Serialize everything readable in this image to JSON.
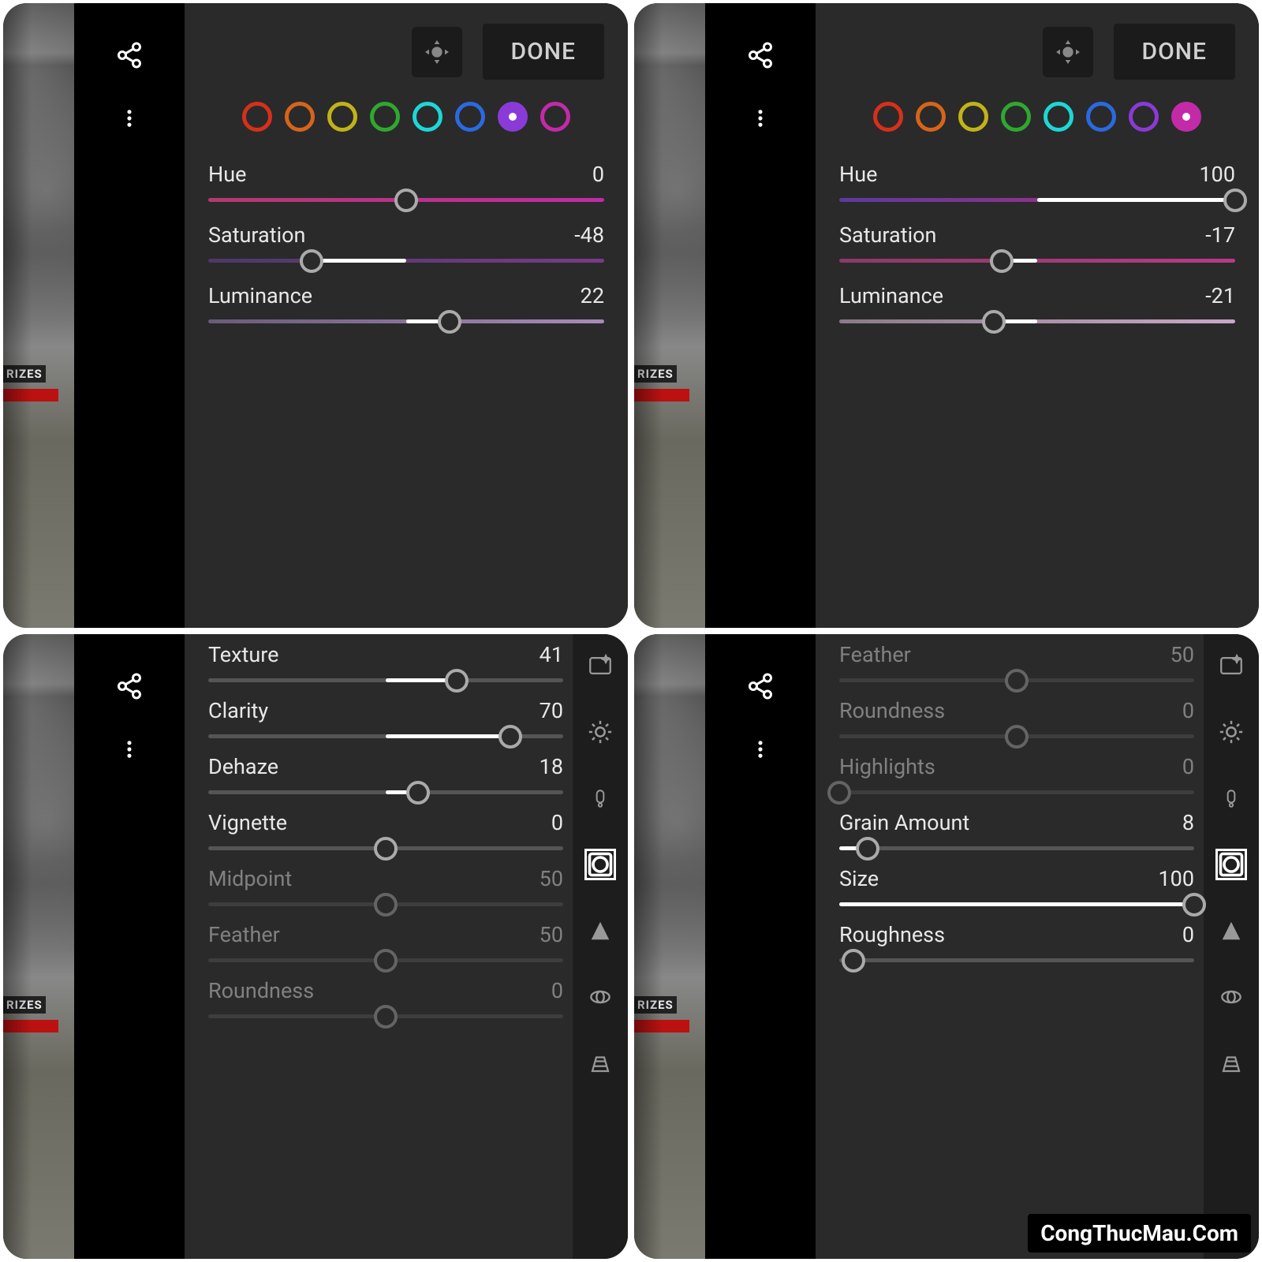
{
  "top": {
    "done": "DONE",
    "prizes": "RIZES"
  },
  "swatchColors": [
    "#d6301a",
    "#d6641a",
    "#c2b21a",
    "#2fa82f",
    "#1ed6d6",
    "#2a6ae0",
    "#8a3ad6",
    "#c22aa8"
  ],
  "panel1": {
    "selectedSwatch": 6,
    "sliders": [
      {
        "label": "Hue",
        "value": "0",
        "knob": 50,
        "leftColor": "#b23a6e",
        "rightColor": "#c22aa8",
        "fillFrom": 50,
        "fillTo": 50,
        "fillColor": "#fff"
      },
      {
        "label": "Saturation",
        "value": "-48",
        "knob": 26,
        "leftColor": "#4a3a66",
        "rightColor": "#7a3a88",
        "fillFrom": 26,
        "fillTo": 50,
        "fillColor": "#fff"
      },
      {
        "label": "Luminance",
        "value": "22",
        "knob": 61,
        "leftColor": "#6a5a78",
        "rightColor": "#a88ab8",
        "fillFrom": 50,
        "fillTo": 61,
        "fillColor": "#fff"
      }
    ]
  },
  "panel2": {
    "selectedSwatch": 7,
    "sliders": [
      {
        "label": "Hue",
        "value": "100",
        "knob": 100,
        "leftColor": "#5a3aa0",
        "rightColor": "#c22a7a",
        "fillFrom": 50,
        "fillTo": 100,
        "fillColor": "#fff"
      },
      {
        "label": "Saturation",
        "value": "-17",
        "knob": 41,
        "leftColor": "#8a3a66",
        "rightColor": "#b83a88",
        "fillFrom": 41,
        "fillTo": 50,
        "fillColor": "#fff"
      },
      {
        "label": "Luminance",
        "value": "-21",
        "knob": 39,
        "leftColor": "#8a7a88",
        "rightColor": "#c8a8c8",
        "fillFrom": 39,
        "fillTo": 50,
        "fillColor": "#fff"
      }
    ]
  },
  "panel3": {
    "sliders": [
      {
        "label": "Texture",
        "value": "41",
        "knob": 70,
        "dim": false,
        "fillFrom": 50,
        "fillTo": 70
      },
      {
        "label": "Clarity",
        "value": "70",
        "knob": 85,
        "dim": false,
        "fillFrom": 50,
        "fillTo": 85
      },
      {
        "label": "Dehaze",
        "value": "18",
        "knob": 59,
        "dim": false,
        "fillFrom": 50,
        "fillTo": 59
      },
      {
        "label": "Vignette",
        "value": "0",
        "knob": 50,
        "dim": false,
        "fillFrom": 50,
        "fillTo": 50
      },
      {
        "label": "Midpoint",
        "value": "50",
        "knob": 50,
        "dim": true,
        "fillFrom": 50,
        "fillTo": 50
      },
      {
        "label": "Feather",
        "value": "50",
        "knob": 50,
        "dim": true,
        "fillFrom": 50,
        "fillTo": 50
      },
      {
        "label": "Roundness",
        "value": "0",
        "knob": 50,
        "dim": true,
        "fillFrom": 50,
        "fillTo": 50
      }
    ],
    "selectedTool": 3
  },
  "panel4": {
    "sliders": [
      {
        "label": "Feather",
        "value": "50",
        "knob": 50,
        "dim": true,
        "fillFrom": 50,
        "fillTo": 50
      },
      {
        "label": "Roundness",
        "value": "0",
        "knob": 50,
        "dim": true,
        "fillFrom": 50,
        "fillTo": 50
      },
      {
        "label": "Highlights",
        "value": "0",
        "knob": 0,
        "dim": true,
        "fillFrom": 0,
        "fillTo": 0
      },
      {
        "label": "Grain Amount",
        "value": "8",
        "knob": 8,
        "dim": false,
        "fillFrom": 0,
        "fillTo": 8
      },
      {
        "label": "Size",
        "value": "100",
        "knob": 100,
        "dim": false,
        "fillFrom": 0,
        "fillTo": 100
      },
      {
        "label": "Roughness",
        "value": "0",
        "knob": 4,
        "dim": false,
        "fillFrom": 0,
        "fillTo": 0
      }
    ],
    "selectedTool": 3
  },
  "watermark": "CongThucMau.Com"
}
